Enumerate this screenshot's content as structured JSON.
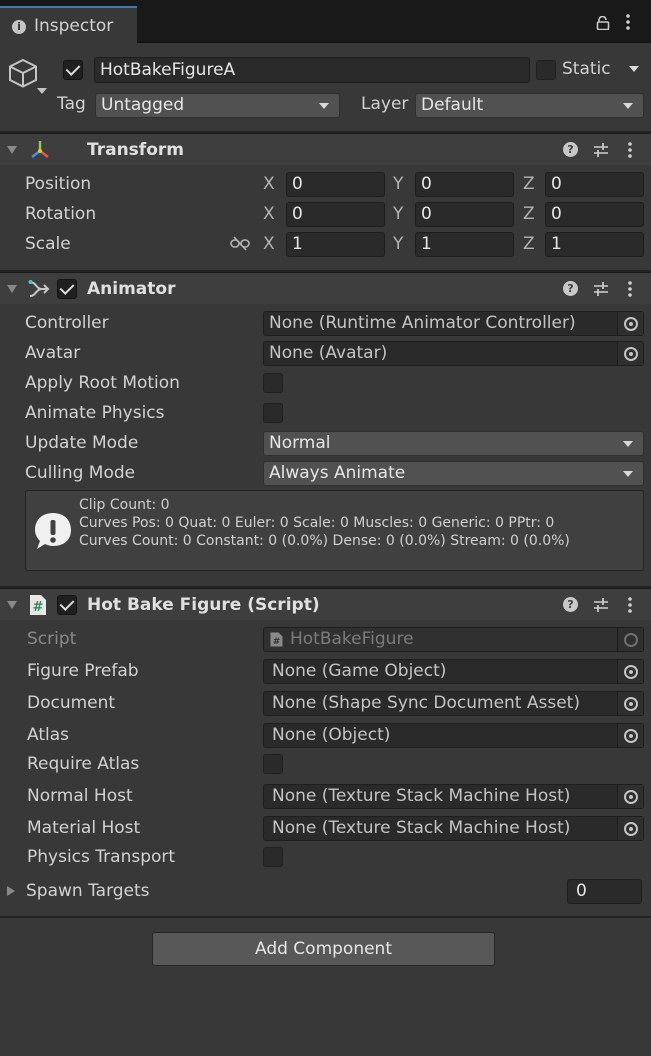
{
  "tab": {
    "title": "Inspector"
  },
  "object": {
    "name": "HotBakeFigureA",
    "active": true,
    "static_label": "Static",
    "static": false,
    "tag_label": "Tag",
    "tag_value": "Untagged",
    "layer_label": "Layer",
    "layer_value": "Default"
  },
  "transform": {
    "title": "Transform",
    "rows": [
      {
        "label": "Position",
        "x": "0",
        "y": "0",
        "z": "0"
      },
      {
        "label": "Rotation",
        "x": "0",
        "y": "0",
        "z": "0"
      },
      {
        "label": "Scale",
        "x": "1",
        "y": "1",
        "z": "1"
      }
    ],
    "axes": {
      "x": "X",
      "y": "Y",
      "z": "Z"
    }
  },
  "animator": {
    "title": "Animator",
    "enabled": true,
    "controller_label": "Controller",
    "controller_value": "None (Runtime Animator Controller)",
    "avatar_label": "Avatar",
    "avatar_value": "None (Avatar)",
    "apply_root_motion_label": "Apply Root Motion",
    "animate_physics_label": "Animate Physics",
    "update_mode_label": "Update Mode",
    "update_mode_value": "Normal",
    "culling_mode_label": "Culling Mode",
    "culling_mode_value": "Always Animate",
    "info_lines": [
      "Clip Count: 0",
      "Curves Pos: 0 Quat: 0 Euler: 0 Scale: 0 Muscles: 0 Generic: 0 PPtr: 0",
      "Curves Count: 0 Constant: 0 (0.0%) Dense: 0 (0.0%) Stream: 0 (0.0%)"
    ]
  },
  "script": {
    "title": "Hot Bake Figure (Script)",
    "enabled": true,
    "script_label": "Script",
    "script_value": "HotBakeFigure",
    "figure_prefab_label": "Figure Prefab",
    "figure_prefab_value": "None (Game Object)",
    "document_label": "Document",
    "document_value": "None (Shape Sync Document Asset)",
    "atlas_label": "Atlas",
    "atlas_value": "None (Object)",
    "require_atlas_label": "Require Atlas",
    "normal_host_label": "Normal Host",
    "normal_host_value": "None (Texture Stack Machine Host)",
    "material_host_label": "Material Host",
    "material_host_value": "None (Texture Stack Machine Host)",
    "physics_transport_label": "Physics Transport",
    "spawn_targets_label": "Spawn Targets",
    "spawn_targets_value": "0"
  },
  "footer": {
    "add_component_label": "Add Component"
  },
  "icons": {
    "help": "?",
    "info": "i",
    "hash": "#"
  }
}
